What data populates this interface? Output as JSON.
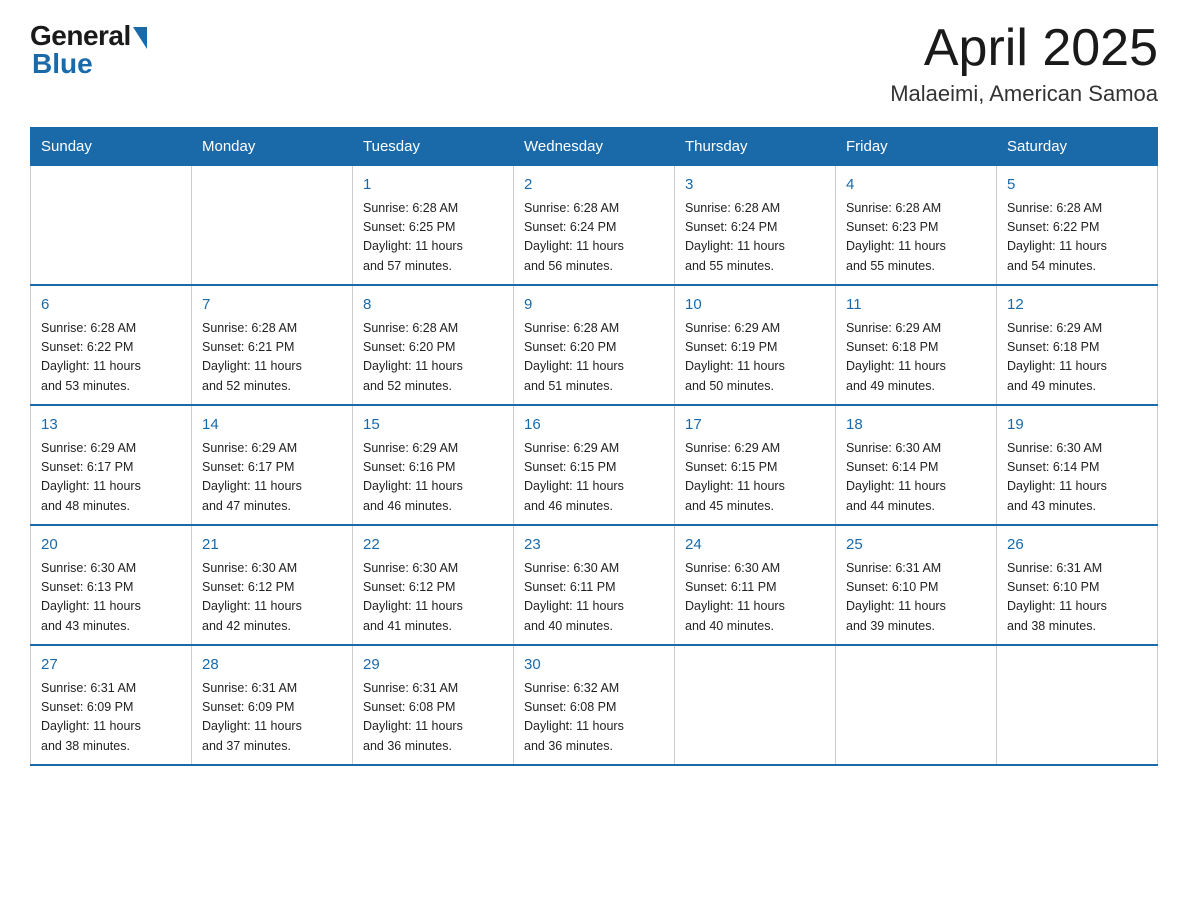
{
  "logo": {
    "general": "General",
    "blue": "Blue"
  },
  "header": {
    "month": "April 2025",
    "location": "Malaeimi, American Samoa"
  },
  "weekdays": [
    "Sunday",
    "Monday",
    "Tuesday",
    "Wednesday",
    "Thursday",
    "Friday",
    "Saturday"
  ],
  "weeks": [
    [
      {
        "day": "",
        "info": ""
      },
      {
        "day": "",
        "info": ""
      },
      {
        "day": "1",
        "info": "Sunrise: 6:28 AM\nSunset: 6:25 PM\nDaylight: 11 hours\nand 57 minutes."
      },
      {
        "day": "2",
        "info": "Sunrise: 6:28 AM\nSunset: 6:24 PM\nDaylight: 11 hours\nand 56 minutes."
      },
      {
        "day": "3",
        "info": "Sunrise: 6:28 AM\nSunset: 6:24 PM\nDaylight: 11 hours\nand 55 minutes."
      },
      {
        "day": "4",
        "info": "Sunrise: 6:28 AM\nSunset: 6:23 PM\nDaylight: 11 hours\nand 55 minutes."
      },
      {
        "day": "5",
        "info": "Sunrise: 6:28 AM\nSunset: 6:22 PM\nDaylight: 11 hours\nand 54 minutes."
      }
    ],
    [
      {
        "day": "6",
        "info": "Sunrise: 6:28 AM\nSunset: 6:22 PM\nDaylight: 11 hours\nand 53 minutes."
      },
      {
        "day": "7",
        "info": "Sunrise: 6:28 AM\nSunset: 6:21 PM\nDaylight: 11 hours\nand 52 minutes."
      },
      {
        "day": "8",
        "info": "Sunrise: 6:28 AM\nSunset: 6:20 PM\nDaylight: 11 hours\nand 52 minutes."
      },
      {
        "day": "9",
        "info": "Sunrise: 6:28 AM\nSunset: 6:20 PM\nDaylight: 11 hours\nand 51 minutes."
      },
      {
        "day": "10",
        "info": "Sunrise: 6:29 AM\nSunset: 6:19 PM\nDaylight: 11 hours\nand 50 minutes."
      },
      {
        "day": "11",
        "info": "Sunrise: 6:29 AM\nSunset: 6:18 PM\nDaylight: 11 hours\nand 49 minutes."
      },
      {
        "day": "12",
        "info": "Sunrise: 6:29 AM\nSunset: 6:18 PM\nDaylight: 11 hours\nand 49 minutes."
      }
    ],
    [
      {
        "day": "13",
        "info": "Sunrise: 6:29 AM\nSunset: 6:17 PM\nDaylight: 11 hours\nand 48 minutes."
      },
      {
        "day": "14",
        "info": "Sunrise: 6:29 AM\nSunset: 6:17 PM\nDaylight: 11 hours\nand 47 minutes."
      },
      {
        "day": "15",
        "info": "Sunrise: 6:29 AM\nSunset: 6:16 PM\nDaylight: 11 hours\nand 46 minutes."
      },
      {
        "day": "16",
        "info": "Sunrise: 6:29 AM\nSunset: 6:15 PM\nDaylight: 11 hours\nand 46 minutes."
      },
      {
        "day": "17",
        "info": "Sunrise: 6:29 AM\nSunset: 6:15 PM\nDaylight: 11 hours\nand 45 minutes."
      },
      {
        "day": "18",
        "info": "Sunrise: 6:30 AM\nSunset: 6:14 PM\nDaylight: 11 hours\nand 44 minutes."
      },
      {
        "day": "19",
        "info": "Sunrise: 6:30 AM\nSunset: 6:14 PM\nDaylight: 11 hours\nand 43 minutes."
      }
    ],
    [
      {
        "day": "20",
        "info": "Sunrise: 6:30 AM\nSunset: 6:13 PM\nDaylight: 11 hours\nand 43 minutes."
      },
      {
        "day": "21",
        "info": "Sunrise: 6:30 AM\nSunset: 6:12 PM\nDaylight: 11 hours\nand 42 minutes."
      },
      {
        "day": "22",
        "info": "Sunrise: 6:30 AM\nSunset: 6:12 PM\nDaylight: 11 hours\nand 41 minutes."
      },
      {
        "day": "23",
        "info": "Sunrise: 6:30 AM\nSunset: 6:11 PM\nDaylight: 11 hours\nand 40 minutes."
      },
      {
        "day": "24",
        "info": "Sunrise: 6:30 AM\nSunset: 6:11 PM\nDaylight: 11 hours\nand 40 minutes."
      },
      {
        "day": "25",
        "info": "Sunrise: 6:31 AM\nSunset: 6:10 PM\nDaylight: 11 hours\nand 39 minutes."
      },
      {
        "day": "26",
        "info": "Sunrise: 6:31 AM\nSunset: 6:10 PM\nDaylight: 11 hours\nand 38 minutes."
      }
    ],
    [
      {
        "day": "27",
        "info": "Sunrise: 6:31 AM\nSunset: 6:09 PM\nDaylight: 11 hours\nand 38 minutes."
      },
      {
        "day": "28",
        "info": "Sunrise: 6:31 AM\nSunset: 6:09 PM\nDaylight: 11 hours\nand 37 minutes."
      },
      {
        "day": "29",
        "info": "Sunrise: 6:31 AM\nSunset: 6:08 PM\nDaylight: 11 hours\nand 36 minutes."
      },
      {
        "day": "30",
        "info": "Sunrise: 6:32 AM\nSunset: 6:08 PM\nDaylight: 11 hours\nand 36 minutes."
      },
      {
        "day": "",
        "info": ""
      },
      {
        "day": "",
        "info": ""
      },
      {
        "day": "",
        "info": ""
      }
    ]
  ]
}
